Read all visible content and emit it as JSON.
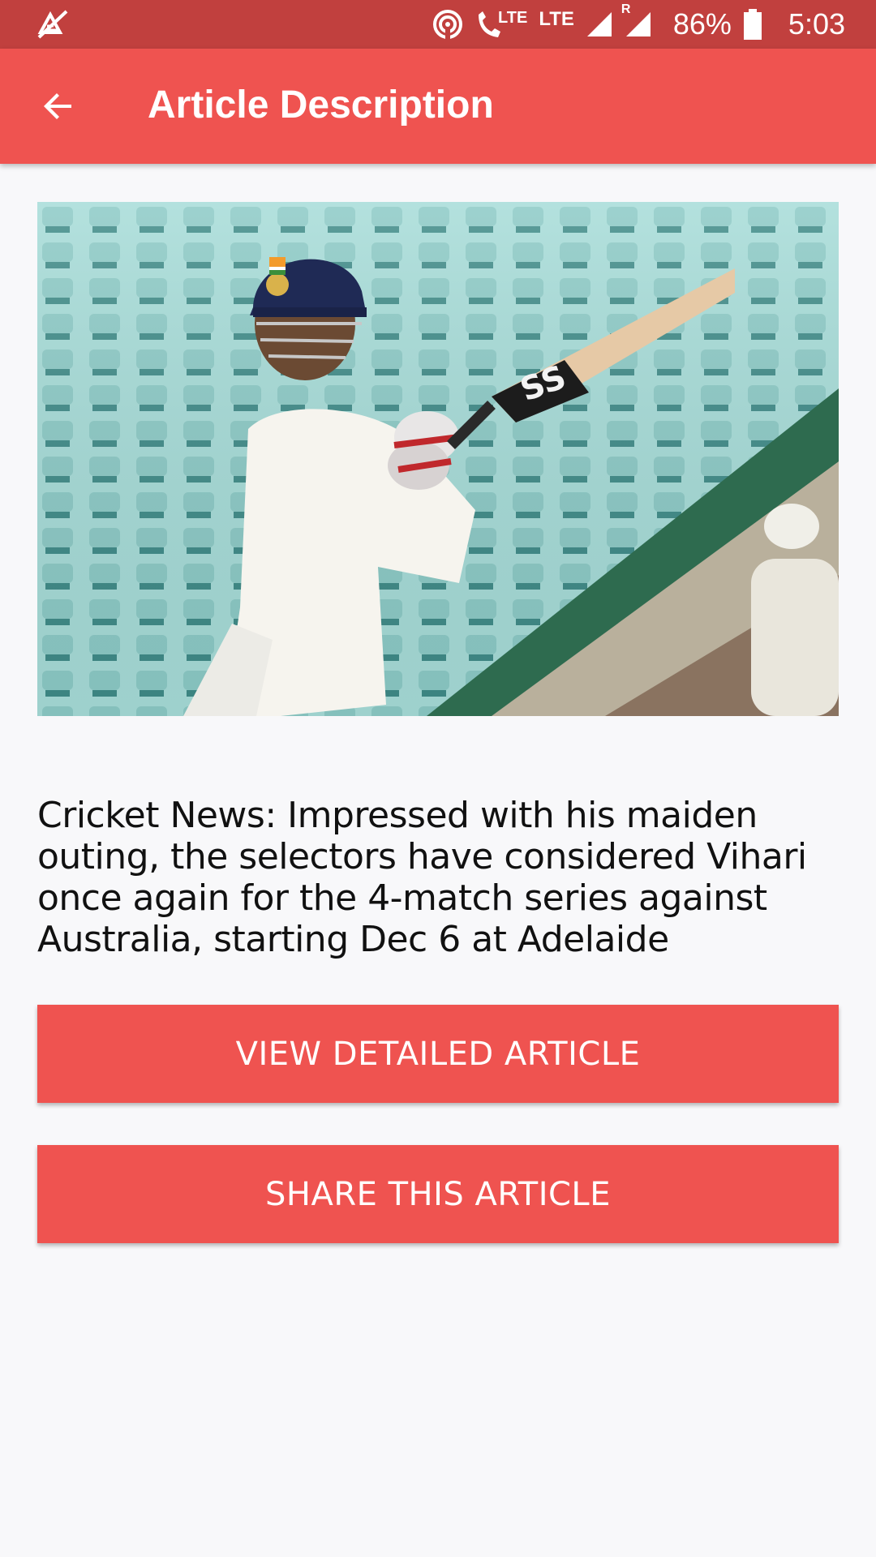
{
  "status_bar": {
    "battery_percent": "86%",
    "time": "5:03",
    "lte_label_1": "LTE",
    "lte_label_2": "LTE",
    "roaming_label": "R",
    "icons": [
      "no-sim-icon",
      "hotspot-icon",
      "volte-call-icon",
      "signal-icon",
      "signal-roaming-icon",
      "battery-icon"
    ]
  },
  "app_bar": {
    "title": "Article Description",
    "back_icon": "arrow-back-icon"
  },
  "article": {
    "image_label": "cricket-batsman-photo",
    "summary": "Cricket News: Impressed with his maiden outing, the selectors have considered Vihari once again for the 4-match series against Australia, starting Dec 6 at Adelaide",
    "bat_logo_text": "SS"
  },
  "actions": {
    "view_label": "VIEW DETAILED ARTICLE",
    "share_label": "SHARE THIS ARTICLE"
  },
  "colors": {
    "status_bar": "#c1403e",
    "app_bar": "#ef5350",
    "button": "#ef5350",
    "background": "#f8f8fa"
  }
}
